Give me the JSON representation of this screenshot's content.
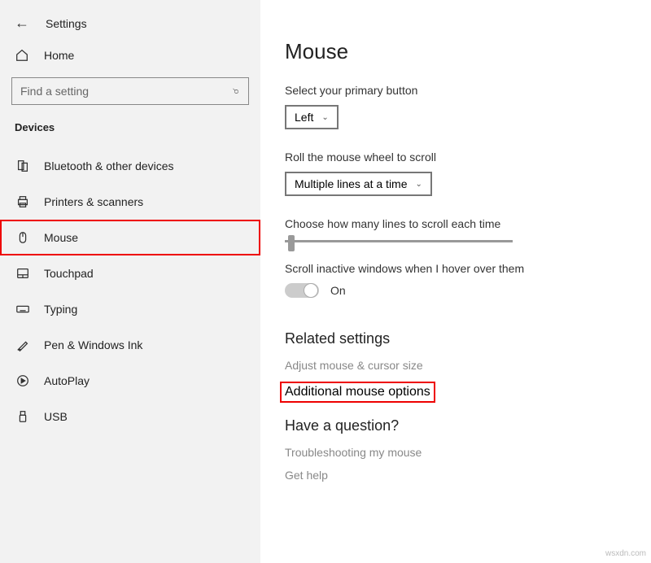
{
  "header": {
    "back": "←",
    "title": "Settings"
  },
  "home": {
    "label": "Home"
  },
  "search": {
    "placeholder": "Find a setting"
  },
  "category": "Devices",
  "nav": [
    {
      "label": "Bluetooth & other devices"
    },
    {
      "label": "Printers & scanners"
    },
    {
      "label": "Mouse"
    },
    {
      "label": "Touchpad"
    },
    {
      "label": "Typing"
    },
    {
      "label": "Pen & Windows Ink"
    },
    {
      "label": "AutoPlay"
    },
    {
      "label": "USB"
    }
  ],
  "main": {
    "title": "Mouse",
    "primary_label": "Select your primary button",
    "primary_value": "Left",
    "scroll_label": "Roll the mouse wheel to scroll",
    "scroll_value": "Multiple lines at a time",
    "lines_label": "Choose how many lines to scroll each time",
    "inactive_label": "Scroll inactive windows when I hover over them",
    "inactive_value": "On",
    "related_head": "Related settings",
    "related_link1": "Adjust mouse & cursor size",
    "related_link2": "Additional mouse options",
    "question_head": "Have a question?",
    "question_link1": "Troubleshooting my mouse",
    "question_link2": "Get help"
  },
  "watermark": "wsxdn.com"
}
